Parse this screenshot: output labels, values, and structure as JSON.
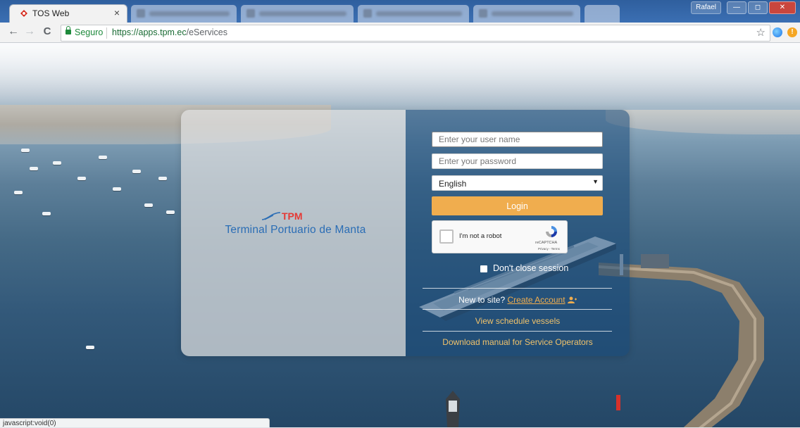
{
  "browser": {
    "active_tab_title": "TOS Web",
    "tab_close_glyph": "×",
    "other_tabs_count": 5,
    "window_user_label": "Rafael",
    "nav_back": "←",
    "nav_forward": "→",
    "nav_reload": "C",
    "secure_label": "Seguro",
    "url_host": "https://apps.tpm.ec",
    "url_path": "/eServices",
    "bookmark_icon": "star-icon",
    "status_text": "javascript:void(0)"
  },
  "login": {
    "brand_short": "TPM",
    "brand_name": "Terminal Portuario de Manta",
    "username_placeholder": "Enter your user name",
    "password_placeholder": "Enter your password",
    "language_selected": "English",
    "login_button": "Login",
    "captcha_label": "I'm not a robot",
    "captcha_brand": "reCAPTCHA",
    "captcha_terms": "Privacy - Terms",
    "keep_session_label": "Don't close session",
    "new_to_site_text": "New to site?",
    "create_account_link": "Create Account",
    "schedule_link": "View schedule vessels",
    "manual_link": "Download manual for Service Operators"
  },
  "colors": {
    "accent_button": "#f0ad4e",
    "brand_blue": "#2a6db5",
    "brand_red": "#e53935",
    "link_yellow": "#f0c26b"
  }
}
